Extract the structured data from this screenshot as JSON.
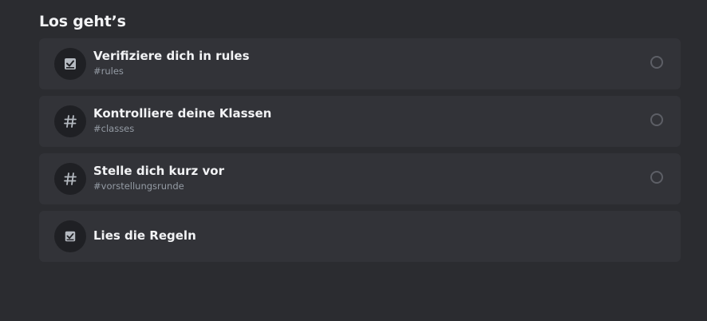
{
  "section": {
    "title": "Los geht’s"
  },
  "items": [
    {
      "title": "Verifiziere dich in rules",
      "channel": "#rules",
      "icon": "rules-checkbox-icon",
      "has_check": true
    },
    {
      "title": "Kontrolliere deine Klassen",
      "channel": "#classes",
      "icon": "hashtag-icon",
      "has_check": true
    },
    {
      "title": "Stelle dich kurz vor",
      "channel": "#vorstellungsrunde",
      "icon": "hashtag-icon",
      "has_check": true
    },
    {
      "title": "Lies die Regeln",
      "icon": "rules-checkbox-icon",
      "has_check": false
    }
  ],
  "colors": {
    "background": "#2b2c30",
    "card": "#323338",
    "icon_bg": "#1f2024",
    "muted_text": "#949ba4",
    "check_border": "#5d5f66"
  }
}
